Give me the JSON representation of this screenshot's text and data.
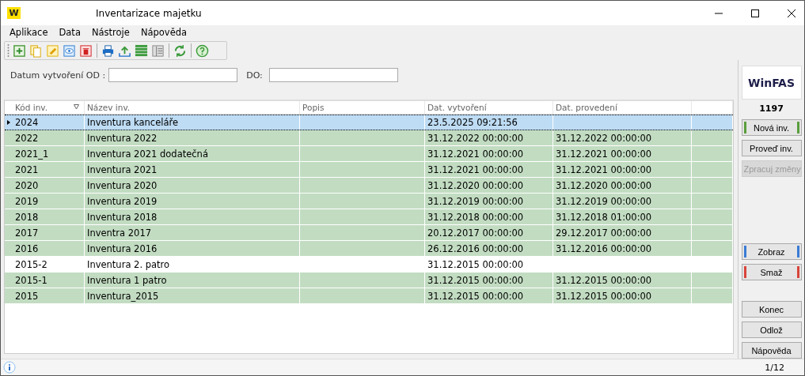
{
  "window": {
    "title": "Inventarizace majetku",
    "logo": "W"
  },
  "menu": [
    "Aplikace",
    "Data",
    "Nástroje",
    "Nápověda"
  ],
  "filter": {
    "from_label": "Datum vytvoření OD :",
    "to_label": "DO:"
  },
  "table": {
    "columns": [
      "Kód inv.",
      "Název inv.",
      "Popis",
      "Dat. vytvoření",
      "Dat. provedení"
    ],
    "rows": [
      {
        "kind": "done",
        "selected": true,
        "cells": [
          "2024",
          "Inventura kanceláře",
          "",
          "23.5.2025 09:21:56",
          ""
        ]
      },
      {
        "kind": "done",
        "selected": false,
        "cells": [
          "2022",
          "Inventura 2022",
          "",
          "31.12.2022 00:00:00",
          "31.12.2022 00:00:00"
        ]
      },
      {
        "kind": "done",
        "selected": false,
        "cells": [
          "2021_1",
          "Inventura 2021 dodatečná",
          "",
          "31.12.2021 00:00:00",
          "31.12.2021 00:00:00"
        ]
      },
      {
        "kind": "done",
        "selected": false,
        "cells": [
          "2021",
          "Inventura 2021",
          "",
          "31.12.2021 00:00:00",
          "31.12.2021 00:00:00"
        ]
      },
      {
        "kind": "done",
        "selected": false,
        "cells": [
          "2020",
          "Inventura 2020",
          "",
          "31.12.2020 00:00:00",
          "31.12.2020 00:00:00"
        ]
      },
      {
        "kind": "done",
        "selected": false,
        "cells": [
          "2019",
          "Inventura 2019",
          "",
          "31.12.2019 00:00:00",
          "31.12.2019 00:00:00"
        ]
      },
      {
        "kind": "done",
        "selected": false,
        "cells": [
          "2018",
          "Inventura 2018",
          "",
          "31.12.2018 00:00:00",
          "31.12.2018 01:00:00"
        ]
      },
      {
        "kind": "done",
        "selected": false,
        "cells": [
          "2017",
          "Inventra 2017",
          "",
          "20.12.2017 00:00:00",
          "29.12.2017 00:00:00"
        ]
      },
      {
        "kind": "done",
        "selected": false,
        "cells": [
          "2016",
          "Inventura 2016",
          "",
          "26.12.2016 00:00:00",
          "31.12.2016 00:00:00"
        ]
      },
      {
        "kind": "open",
        "selected": false,
        "cells": [
          "2015-2",
          "Inventura 2. patro",
          "",
          "31.12.2015 00:00:00",
          ""
        ]
      },
      {
        "kind": "done",
        "selected": false,
        "cells": [
          "2015-1",
          "Inventura 1 patro",
          "",
          "31.12.2015 00:00:00",
          "31.12.2015 00:00:00"
        ]
      },
      {
        "kind": "done",
        "selected": false,
        "cells": [
          "2015",
          "Inventura_2015",
          "",
          "31.12.2015 00:00:00",
          "31.12.2015 00:00:00"
        ]
      }
    ]
  },
  "side": {
    "logo": "WinFAS",
    "count": "1197",
    "buttons": [
      {
        "label": "Nová inv.",
        "color": "#5a9e3e",
        "disabled": false
      },
      {
        "label": "Proveď inv.",
        "disabled": false
      },
      {
        "label": "Zpracuj změny",
        "disabled": true
      },
      {
        "label": "Zobraz",
        "color": "#3a7bd5",
        "disabled": false
      },
      {
        "label": "Smaž",
        "color": "#d9443a",
        "disabled": false
      },
      {
        "label": "Konec",
        "disabled": false
      },
      {
        "label": "Odlož",
        "disabled": false
      },
      {
        "label": "Nápověda",
        "disabled": false
      }
    ]
  },
  "status_bar": {
    "page": "1/12"
  }
}
